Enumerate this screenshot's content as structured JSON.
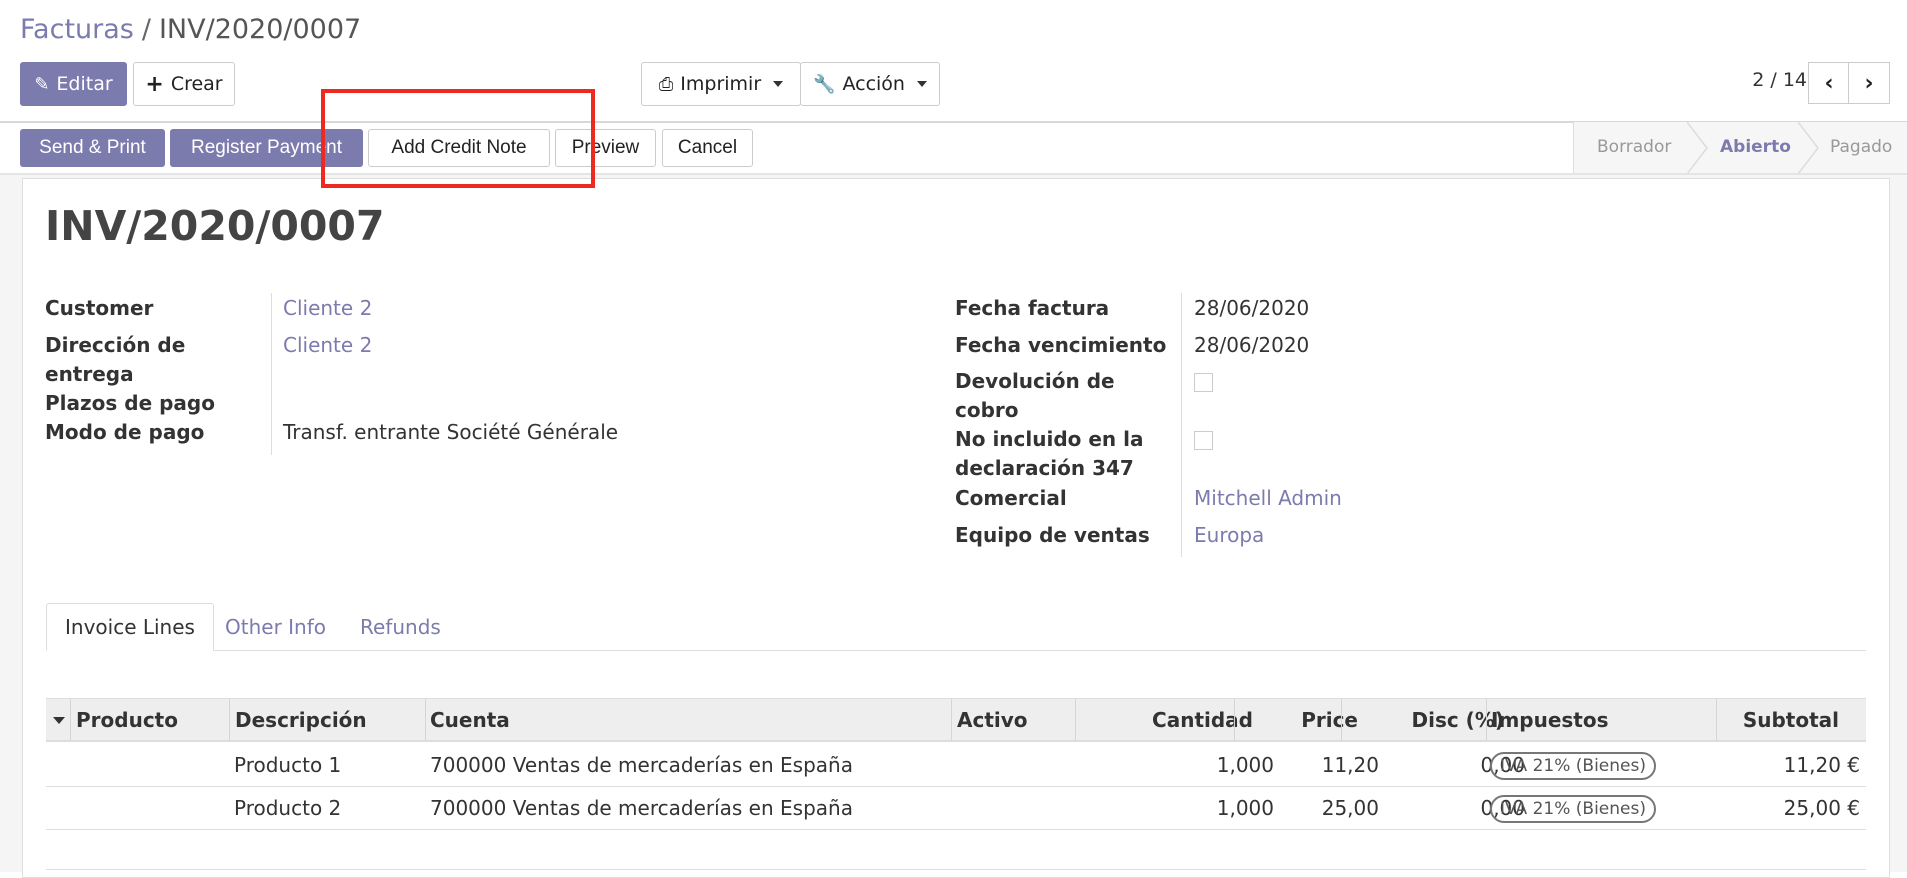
{
  "breadcrumb": {
    "parent": "Facturas",
    "separator": "/",
    "current": "INV/2020/0007"
  },
  "toolbar": {
    "edit_label": "Editar",
    "create_label": "Crear",
    "print_label": "Imprimir",
    "action_label": "Acción"
  },
  "pager": {
    "text": "2 / 14",
    "prev": "‹",
    "next": "›"
  },
  "statusbar_buttons": {
    "send_print": "Send & Print",
    "register_payment": "Register Payment",
    "add_credit_note": "Add Credit Note",
    "preview": "Preview",
    "cancel": "Cancel"
  },
  "stages": [
    "Borrador",
    "Abierto",
    "Pagado"
  ],
  "active_stage": "Abierto",
  "title": "INV/2020/0007",
  "left_fields": {
    "customer_label": "Customer",
    "customer_value": "Cliente 2",
    "delivery_label": "Dirección de entrega",
    "delivery_value": "Cliente 2",
    "payment_terms_label": "Plazos de pago",
    "payment_mode_label": "Modo de pago",
    "payment_mode_value": "Transf. entrante Société Générale"
  },
  "right_fields": {
    "invoice_date_label": "Fecha factura",
    "invoice_date_value": "28/06/2020",
    "due_date_label": "Fecha vencimiento",
    "due_date_value": "28/06/2020",
    "refund_label": "Devolución de cobro",
    "excluded_label": "No incluido en la declaración 347",
    "salesperson_label": "Comercial",
    "salesperson_value": "Mitchell Admin",
    "sales_team_label": "Equipo de ventas",
    "sales_team_value": "Europa"
  },
  "tabs": [
    "Invoice Lines",
    "Other Info",
    "Refunds"
  ],
  "table": {
    "headers": [
      "Producto",
      "Descripción",
      "Cuenta",
      "Activo",
      "Cantidad",
      "Price",
      "Disc (%)",
      "Impuestos",
      "Subtotal"
    ],
    "rows": [
      {
        "producto": "",
        "descripcion": "Producto 1",
        "cuenta": "700000 Ventas de mercaderías en España",
        "activo": "",
        "cantidad": "1,000",
        "price": "11,20",
        "disc": "0,00",
        "impuestos": "IVA 21% (Bienes)",
        "subtotal": "11,20 €"
      },
      {
        "producto": "",
        "descripcion": "Producto 2",
        "cuenta": "700000 Ventas de mercaderías en España",
        "activo": "",
        "cantidad": "1,000",
        "price": "25,00",
        "disc": "0,00",
        "impuestos": "IVA 21% (Bienes)",
        "subtotal": "25,00 €"
      }
    ]
  },
  "colors": {
    "brand": "#7c7bad",
    "highlight": "#ec2a22"
  }
}
